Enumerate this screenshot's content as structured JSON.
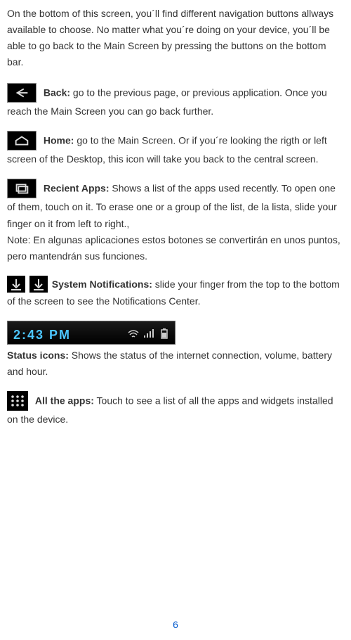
{
  "intro": "On the bottom of this screen, you´ll find different navigation buttons allways available to choose. No matter what you´re doing on your device, you´ll be able to go back to the Main Screen by pressing  the buttons on the bottom bar.",
  "sections": {
    "back": {
      "title": "Back:",
      "body": " go to the previous page, or previous application. Once you reach the Main Screen you can go back further."
    },
    "home": {
      "title": "Home:",
      "body": " go to the Main Screen. Or if you´re looking the rigth or left screen of the Desktop, this icon will take you back to the central screen."
    },
    "recent": {
      "title": "Recient Apps:",
      "body": " Shows a list of the apps used recently. To open one of them, touch on it. To erase one or a group of the list, de la lista, slide your finger on it from left to right.,",
      "note": "Note: En algunas aplicaciones estos botones se convertirán en unos puntos, pero mantendrán sus funciones."
    },
    "notif": {
      "title": "System Notifications:",
      "body": " slide your finger from the top to the bottom of the screen to see the Notifications Center."
    },
    "status": {
      "title": "Status icons:",
      "body": " Shows the status of the internet connection, volume, battery and hour.",
      "clock": "2:43  PM"
    },
    "allapps": {
      "title": "All the apps:",
      "body": " Touch to see a list of all the apps and widgets installed on the device."
    }
  },
  "page_number": "6"
}
